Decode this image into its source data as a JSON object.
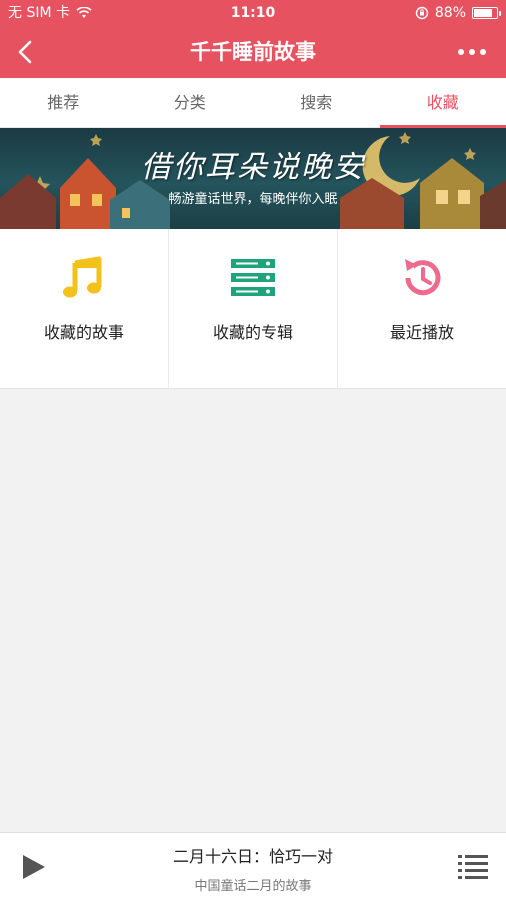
{
  "status_bar": {
    "carrier": "无 SIM 卡",
    "time": "11:10",
    "battery_percent": "88%",
    "battery_level": 0.88
  },
  "navbar": {
    "title": "千千睡前故事",
    "back_icon": "chevron-left-icon",
    "more_icon": "more-horizontal-icon"
  },
  "tabs": [
    {
      "label": "推荐",
      "active": false
    },
    {
      "label": "分类",
      "active": false
    },
    {
      "label": "搜索",
      "active": false
    },
    {
      "label": "收藏",
      "active": true
    }
  ],
  "banner": {
    "title": "借你耳朵说晚安",
    "subtitle": "畅游童话世界，每晚伴你入眠"
  },
  "grid": [
    {
      "label": "收藏的故事",
      "icon": "music-note-icon",
      "color": "#f2c21b"
    },
    {
      "label": "收藏的专辑",
      "icon": "album-list-icon",
      "color": "#1fa37a"
    },
    {
      "label": "最近播放",
      "icon": "history-icon",
      "color": "#ef6a8c"
    }
  ],
  "player": {
    "title": "二月十六日：恰巧一对",
    "subtitle": "中国童话二月的故事",
    "play_icon": "play-icon",
    "playlist_icon": "playlist-icon"
  },
  "colors": {
    "accent": "#e6525f",
    "background": "#f2f2f2"
  }
}
